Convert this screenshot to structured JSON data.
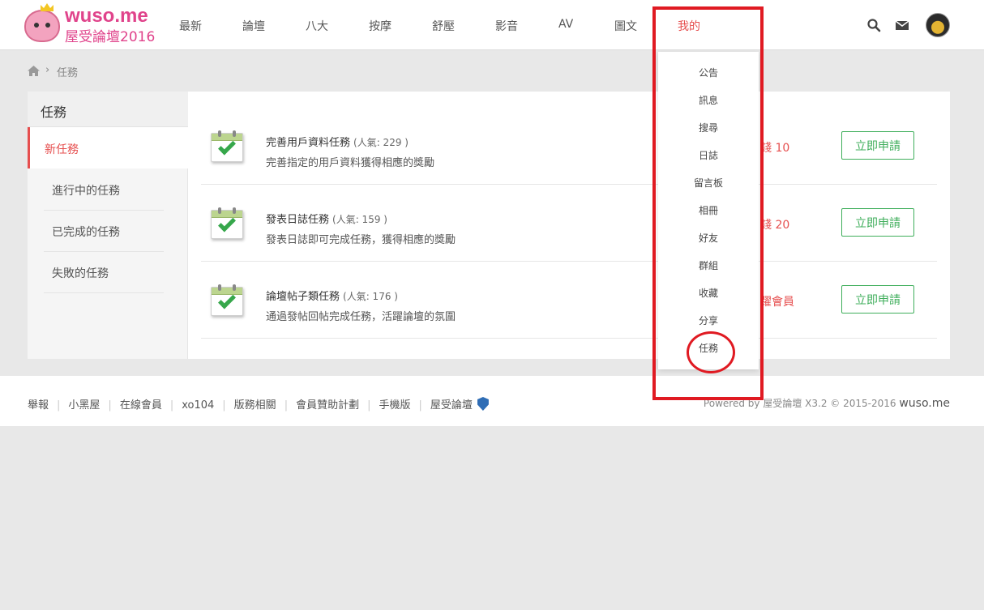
{
  "header": {
    "logo_title": "wuso.me",
    "logo_sub": "屋受論壇2016",
    "nav": [
      "最新",
      "論壇",
      "八大",
      "按摩",
      "舒壓",
      "影音",
      "AV",
      "圖文",
      "我的"
    ],
    "active_nav": "我的"
  },
  "icons": {
    "search": "search-icon",
    "mail": "mail-icon",
    "home": "home-icon",
    "calendar_check": "calendar-check-icon",
    "shield": "shield-icon"
  },
  "breadcrumb": {
    "separator": "›",
    "current": "任務"
  },
  "sidebar": {
    "title": "任務",
    "items": [
      {
        "label": "新任務",
        "active": true
      },
      {
        "label": "進行中的任務",
        "active": false
      },
      {
        "label": "已完成的任務",
        "active": false
      },
      {
        "label": "失敗的任務",
        "active": false
      }
    ]
  },
  "tasks": [
    {
      "title": "完善用戶資料任務",
      "popularity": "(人氣: 229 )",
      "desc": "完善指定的用戶資料獲得相應的獎勵",
      "reward": "錢 10",
      "button": "立即申請"
    },
    {
      "title": "發表日誌任務",
      "popularity": "(人氣: 159 )",
      "desc": "發表日誌即可完成任務，獲得相應的獎勵",
      "reward": "錢 20",
      "button": "立即申請"
    },
    {
      "title": "論壇帖子類任務",
      "popularity": "(人氣: 176 )",
      "desc": "通過發帖回帖完成任務，活躍論壇的氛圍",
      "reward": "躍會員",
      "button": "立即申請"
    }
  ],
  "dropdown": {
    "items": [
      "公告",
      "訊息",
      "搜尋",
      "日誌",
      "留言板",
      "相冊",
      "好友",
      "群組",
      "收藏",
      "分享",
      "任務"
    ]
  },
  "footer": {
    "links": [
      "舉報",
      "小黑屋",
      "在線會員",
      "xo104",
      "版務相關",
      "會員贊助計劃",
      "手機版",
      "屋受論壇"
    ],
    "powered_by": "Powered by",
    "powered_name": "屋受論壇",
    "version": "X3.2",
    "copyright": "© 2015-2016",
    "brand": "wuso.me"
  },
  "colors": {
    "accent_red": "#e64e4e",
    "button_green": "#3fae5b",
    "logo_pink": "#e0438b",
    "annotation_red": "#e01a22"
  }
}
